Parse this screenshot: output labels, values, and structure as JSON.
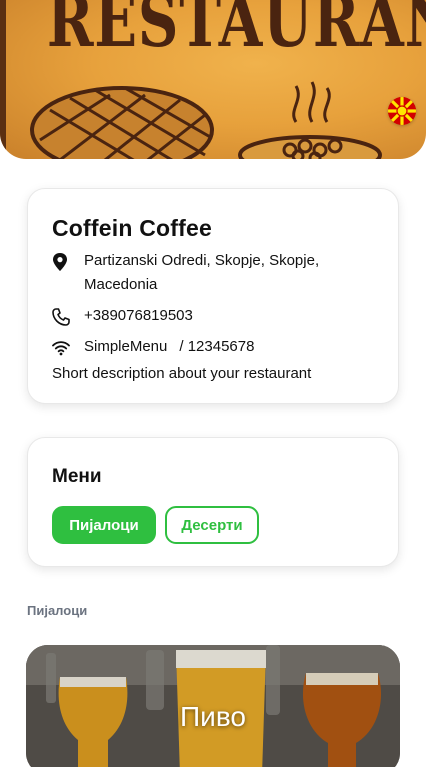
{
  "hero": {
    "title": "RESTAURANT",
    "language_flag": "macedonia-flag-icon"
  },
  "restaurant": {
    "name": "Coffein Coffee",
    "address": "Partizanski Odredi, Skopje, Skopje, Macedonia",
    "phone": "+389076819503",
    "wifi_name": "SimpleMenu",
    "wifi_password": "/ 12345678",
    "description": "Short description about your restaurant"
  },
  "menu": {
    "title": "Мени",
    "tabs": [
      {
        "label": "Пијалоци",
        "active": true
      },
      {
        "label": "Десерти",
        "active": false
      }
    ]
  },
  "section": {
    "label": "Пијалоци"
  },
  "categories": [
    {
      "title": "Пиво"
    }
  ],
  "colors": {
    "accent": "#2fbf40",
    "hero_bg": "#e7a13c",
    "hero_text": "#4a2410"
  }
}
